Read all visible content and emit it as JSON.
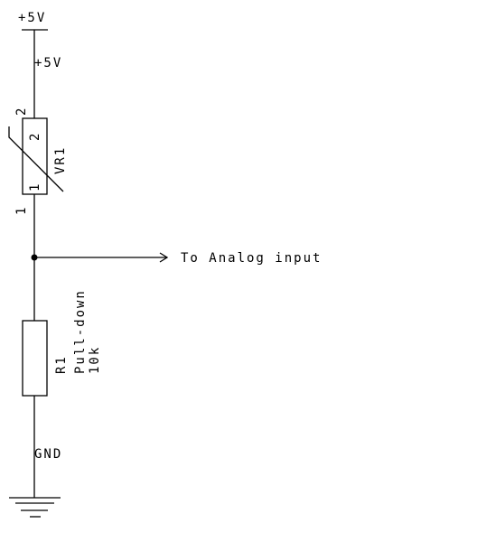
{
  "power": {
    "symbol_label": "+5V",
    "net_label": "+5V"
  },
  "vr1": {
    "ref": "VR1",
    "pin_top_outer": "2",
    "pin_top_inner": "2",
    "pin_bottom_inner": "1",
    "pin_bottom_outer": "1"
  },
  "output": {
    "label": "To Analog input"
  },
  "r1": {
    "ref": "R1",
    "description": "Pull-down",
    "value": "10k"
  },
  "ground": {
    "net_label": "GND"
  }
}
